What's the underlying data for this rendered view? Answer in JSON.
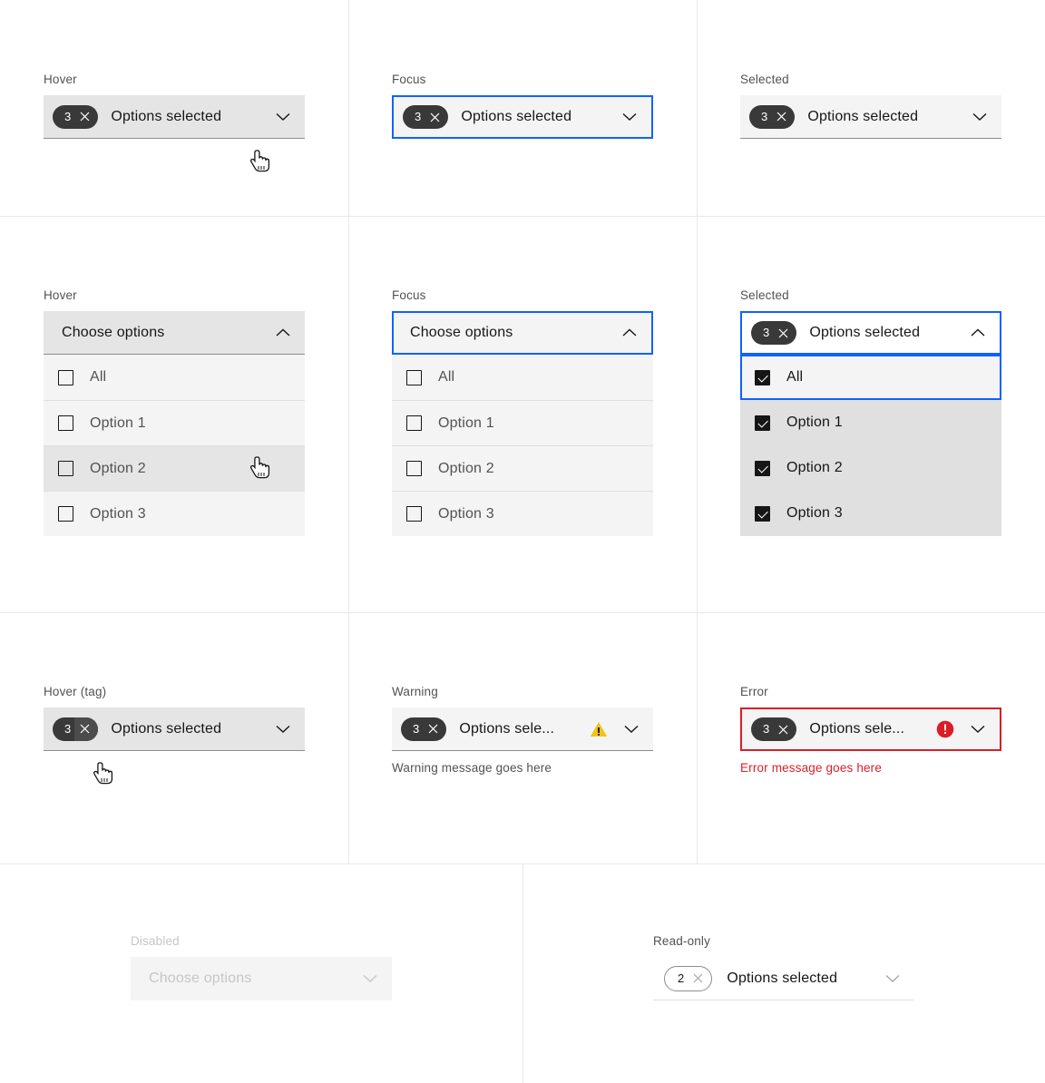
{
  "colors": {
    "focus_blue": "#0f62fe",
    "error_red": "#da1e28",
    "warning_yellow": "#f1c21b",
    "tag_dark": "#393939",
    "field_bg": "#f4f4f4",
    "field_hover_bg": "#e5e5e5",
    "menu_selected_bg": "#e0e0e0"
  },
  "cells": {
    "hover_closed": {
      "label": "Hover",
      "tag_count": "3",
      "value": "Options selected",
      "chevron": "chevron-down-icon"
    },
    "focus_closed": {
      "label": "Focus",
      "tag_count": "3",
      "value": "Options selected",
      "chevron": "chevron-down-icon"
    },
    "selected_closed": {
      "label": "Selected",
      "tag_count": "3",
      "value": "Options selected",
      "chevron": "chevron-down-icon"
    },
    "hover_open": {
      "label": "Hover",
      "placeholder": "Choose options",
      "chevron": "chevron-up-icon",
      "items": [
        {
          "label": "All",
          "checked": false,
          "state": "normal"
        },
        {
          "label": "Option 1",
          "checked": false,
          "state": "normal"
        },
        {
          "label": "Option 2",
          "checked": false,
          "state": "hover"
        },
        {
          "label": "Option 3",
          "checked": false,
          "state": "normal"
        }
      ]
    },
    "focus_open": {
      "label": "Focus",
      "placeholder": "Choose options",
      "chevron": "chevron-up-icon",
      "items": [
        {
          "label": "All",
          "checked": false,
          "state": "normal"
        },
        {
          "label": "Option 1",
          "checked": false,
          "state": "normal"
        },
        {
          "label": "Option 2",
          "checked": false,
          "state": "normal"
        },
        {
          "label": "Option 3",
          "checked": false,
          "state": "normal"
        }
      ]
    },
    "selected_open": {
      "label": "Selected",
      "tag_count": "3",
      "value": "Options selected",
      "chevron": "chevron-up-icon",
      "items": [
        {
          "label": "All",
          "checked": true,
          "state": "focused"
        },
        {
          "label": "Option 1",
          "checked": true,
          "state": "normal"
        },
        {
          "label": "Option 2",
          "checked": true,
          "state": "normal"
        },
        {
          "label": "Option 3",
          "checked": true,
          "state": "normal"
        }
      ]
    },
    "hover_tag": {
      "label": "Hover (tag)",
      "tag_count": "3",
      "value": "Options selected",
      "chevron": "chevron-down-icon"
    },
    "warning": {
      "label": "Warning",
      "tag_count": "3",
      "value": "Options sele...",
      "status_icon": "warning-icon",
      "chevron": "chevron-down-icon",
      "message": "Warning message goes here"
    },
    "error": {
      "label": "Error",
      "tag_count": "3",
      "value": "Options sele...",
      "status_icon": "error-icon",
      "chevron": "chevron-down-icon",
      "message": "Error message goes here"
    },
    "disabled": {
      "label": "Disabled",
      "placeholder": "Choose options",
      "chevron": "chevron-down-icon"
    },
    "readonly": {
      "label": "Read-only",
      "tag_count": "2",
      "value": "Options selected",
      "chevron": "chevron-down-icon"
    }
  }
}
